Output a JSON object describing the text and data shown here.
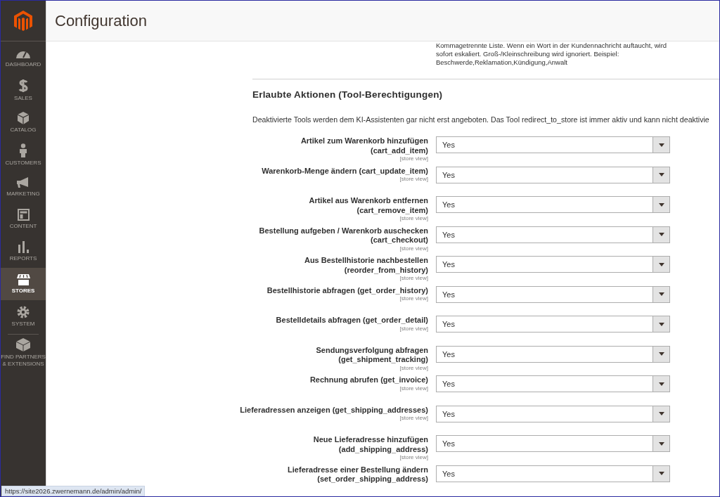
{
  "page_title": "Configuration",
  "sidebar": {
    "items": [
      {
        "label": "DASHBOARD",
        "selected": false
      },
      {
        "label": "SALES",
        "selected": false
      },
      {
        "label": "CATALOG",
        "selected": false
      },
      {
        "label": "CUSTOMERS",
        "selected": false
      },
      {
        "label": "MARKETING",
        "selected": false
      },
      {
        "label": "CONTENT",
        "selected": false
      },
      {
        "label": "REPORTS",
        "selected": false
      },
      {
        "label": "STORES",
        "selected": true
      },
      {
        "label": "SYSTEM",
        "selected": false
      },
      {
        "label": "FIND PARTNERS & EXTENSIONS",
        "selected": false
      }
    ]
  },
  "previous_field_note": [
    "Kommagetrennte Liste. Wenn ein Wort in der Kundennachricht auftaucht, wird",
    "sofort eskaliert. Groß-/Kleinschreibung wird ignoriert. Beispiel:",
    "Beschwerde,Reklamation,Kündigung,Anwalt"
  ],
  "section": {
    "title": "Erlaubte Aktionen (Tool-Berechtigungen)",
    "description": "Deaktivierte Tools werden dem KI-Assistenten gar nicht erst angeboten. Das Tool redirect_to_store ist immer aktiv und kann nicht deaktivie",
    "fields": [
      {
        "label": [
          "Artikel zum Warenkorb hinzufügen",
          "(cart_add_item)"
        ],
        "scope": "[store view]",
        "value": "Yes"
      },
      {
        "label": [
          "Warenkorb-Menge ändern (cart_update_item)"
        ],
        "scope": "[store view]",
        "value": "Yes"
      },
      {
        "label": [
          "Artikel aus Warenkorb entfernen",
          "(cart_remove_item)"
        ],
        "scope": "[store view]",
        "value": "Yes"
      },
      {
        "label": [
          "Bestellung aufgeben / Warenkorb auschecken",
          "(cart_checkout)"
        ],
        "scope": "[store view]",
        "value": "Yes"
      },
      {
        "label": [
          "Aus Bestellhistorie nachbestellen",
          "(reorder_from_history)"
        ],
        "scope": "[store view]",
        "value": "Yes"
      },
      {
        "label": [
          "Bestellhistorie abfragen (get_order_history)"
        ],
        "scope": "[store view]",
        "value": "Yes"
      },
      {
        "label": [
          "Bestelldetails abfragen (get_order_detail)"
        ],
        "scope": "[store view]",
        "value": "Yes"
      },
      {
        "label": [
          "Sendungsverfolgung abfragen",
          "(get_shipment_tracking)"
        ],
        "scope": "[store view]",
        "value": "Yes"
      },
      {
        "label": [
          "Rechnung abrufen (get_invoice)"
        ],
        "scope": "[store view]",
        "value": "Yes"
      },
      {
        "label": [
          "Lieferadressen anzeigen (get_shipping_addresses)"
        ],
        "scope": "[store view]",
        "value": "Yes"
      },
      {
        "label": [
          "Neue Lieferadresse hinzufügen",
          "(add_shipping_address)"
        ],
        "scope": "[store view]",
        "value": "Yes"
      },
      {
        "label": [
          "Lieferadresse einer Bestellung ändern",
          "(set_order_shipping_address)"
        ],
        "value": "Yes"
      }
    ]
  },
  "status_url": "https://site2026.zwernemann.de/admin/admin/"
}
